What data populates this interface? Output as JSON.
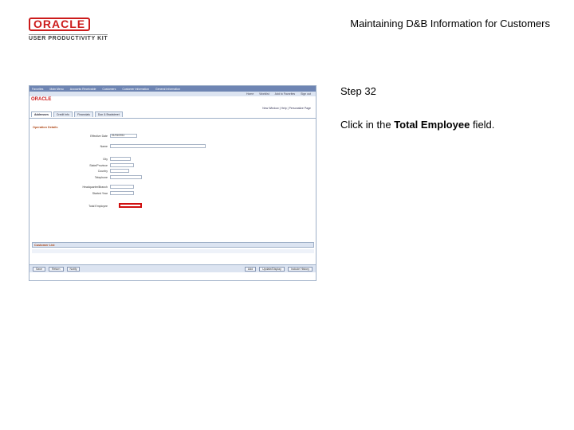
{
  "logo": {
    "brand": "ORACLE",
    "sub": "USER PRODUCTIVITY KIT"
  },
  "doc_title": "Maintaining D&B Information for Customers",
  "step": {
    "label": "Step 32",
    "pre": "Click in the ",
    "field": "Total Employee",
    "post": " field."
  },
  "screenshot": {
    "topbar": [
      "Favorites",
      "Main Menu",
      "Accounts Receivable",
      "Customers",
      "Customer Information",
      "General Information"
    ],
    "menubar": [
      "Home",
      "Worklist",
      "Add to Favorites",
      "Sign out"
    ],
    "brand": "ORACLE",
    "right_links": "New Window | Help | Personalize Page",
    "tabs": [
      "Addresses",
      "Credit Info",
      "Financials",
      "Dun & Bradstreet"
    ],
    "section": "Operation Details",
    "rows": [
      {
        "label": "Effective Date",
        "value": "01/01/2011"
      },
      {
        "label": "Name",
        "value": ""
      },
      {
        "label": "City",
        "value": ""
      },
      {
        "label": "State/Province",
        "value": ""
      },
      {
        "label": "Country",
        "value": ""
      },
      {
        "label": "Telephone",
        "value": ""
      },
      {
        "label": "Headquarter/Branch",
        "value": ""
      },
      {
        "label": "Started Year",
        "value": ""
      },
      {
        "label": "Total Employee",
        "value": ""
      }
    ],
    "grid_title": "Customer List",
    "buttons_left": [
      "Save",
      "Return",
      "Notify"
    ],
    "buttons_right": [
      "Add",
      "Update/Display",
      "Include History"
    ]
  }
}
